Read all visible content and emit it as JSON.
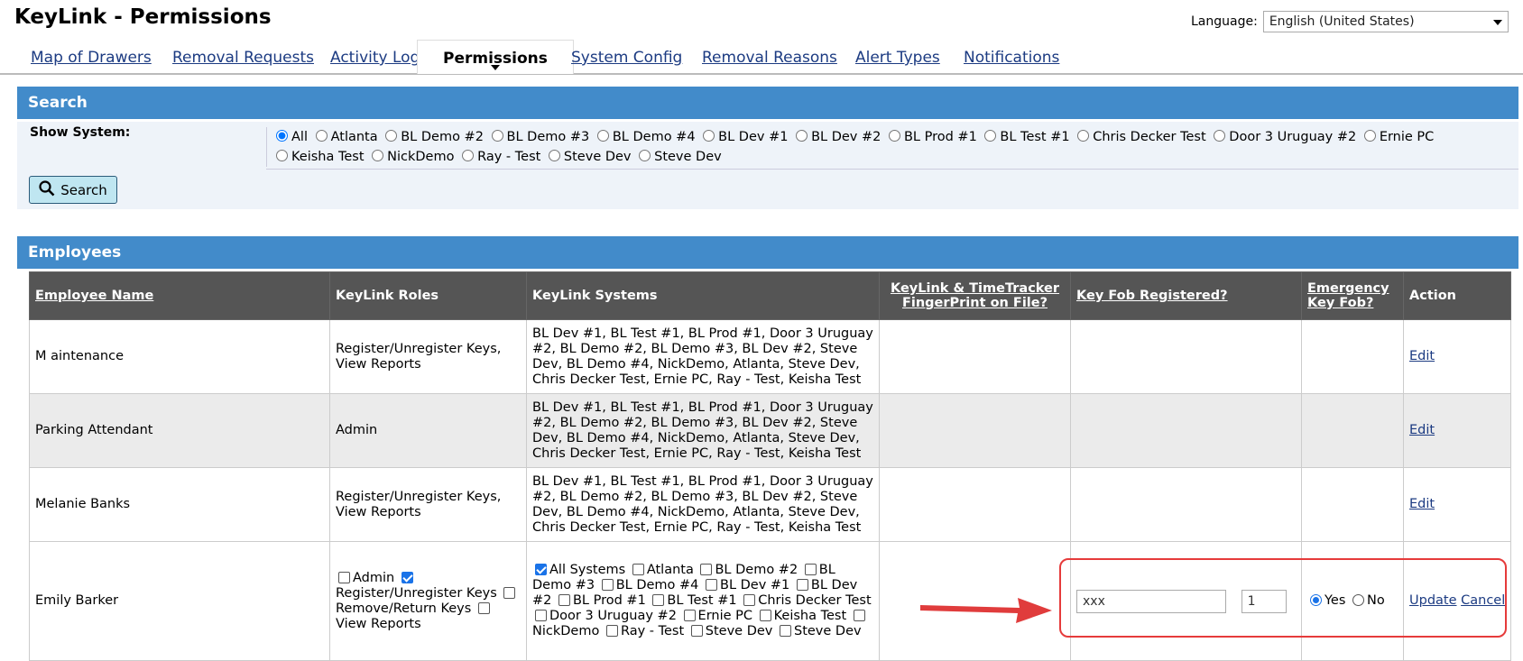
{
  "app_title": "KeyLink - Permissions",
  "language": {
    "label": "Language:",
    "value": "English (United States)"
  },
  "tabs": [
    {
      "label": "Map of Drawers"
    },
    {
      "label": "Removal Requests"
    },
    {
      "label": "Activity Log"
    },
    {
      "label": "Permissions",
      "active": true
    },
    {
      "label": "System Config"
    },
    {
      "label": "Removal Reasons"
    },
    {
      "label": "Alert Types"
    },
    {
      "label": "Notifications"
    }
  ],
  "search": {
    "heading": "Search",
    "show_system_label": "Show System:",
    "systems": [
      "All",
      "Atlanta",
      "BL Demo #2",
      "BL Demo #3",
      "BL Demo #4",
      "BL Dev #1",
      "BL Dev #2",
      "BL Prod #1",
      "BL Test #1",
      "Chris Decker Test",
      "Door 3 Uruguay #2",
      "Ernie PC",
      "Keisha Test",
      "NickDemo",
      "Ray - Test",
      "Steve Dev",
      "Steve Dev"
    ],
    "selected": "All",
    "button_label": "Search"
  },
  "employees": {
    "heading": "Employees",
    "columns": [
      "Employee Name",
      "KeyLink Roles",
      "KeyLink Systems",
      "KeyLink & TimeTracker FingerPrint on File?",
      "Key Fob Registered?",
      "Emergency Key Fob?",
      "Action"
    ],
    "rows": [
      {
        "name": "M aintenance",
        "roles": "Register/Unregister Keys, View Reports",
        "systems": "BL Dev #1, BL Test #1, BL Prod #1, Door 3 Uruguay #2, BL Demo #2, BL Demo #3, BL Dev #2, Steve Dev, BL Demo #4, NickDemo, Atlanta, Steve Dev, Chris Decker Test, Ernie PC, Ray - Test, Keisha Test",
        "fingerprint": "",
        "keyfob": "",
        "emergency": "",
        "action": "Edit"
      },
      {
        "name": "Parking Attendant",
        "roles": "Admin",
        "systems": "BL Dev #1, BL Test #1, BL Prod #1, Door 3 Uruguay #2, BL Demo #2, BL Demo #3, BL Dev #2, Steve Dev, BL Demo #4, NickDemo, Atlanta, Steve Dev, Chris Decker Test, Ernie PC, Ray - Test, Keisha Test",
        "fingerprint": "",
        "keyfob": "",
        "emergency": "",
        "action": "Edit"
      },
      {
        "name": "Melanie Banks",
        "roles": "Register/Unregister Keys, View Reports",
        "systems": "BL Dev #1, BL Test #1, BL Prod #1, Door 3 Uruguay #2, BL Demo #2, BL Demo #3, BL Dev #2, Steve Dev, BL Demo #4, NickDemo, Atlanta, Steve Dev, Chris Decker Test, Ernie PC, Ray - Test, Keisha Test",
        "fingerprint": "",
        "keyfob": "",
        "emergency": "",
        "action": "Edit"
      }
    ],
    "edit_row": {
      "name": "Emily Barker",
      "roles": [
        {
          "label": "Admin",
          "checked": false
        },
        {
          "label": "Register/Unregister Keys",
          "checked": true
        },
        {
          "label": "Remove/Return Keys",
          "checked": false
        },
        {
          "label": "View Reports",
          "checked": false
        }
      ],
      "systems": [
        {
          "label": "All Systems",
          "checked": true
        },
        {
          "label": "Atlanta",
          "checked": false
        },
        {
          "label": "BL Demo #2",
          "checked": false
        },
        {
          "label": "BL Demo #3",
          "checked": false
        },
        {
          "label": "BL Demo #4",
          "checked": false
        },
        {
          "label": "BL Dev #1",
          "checked": false
        },
        {
          "label": "BL Dev #2",
          "checked": false
        },
        {
          "label": "BL Prod #1",
          "checked": false
        },
        {
          "label": "BL Test #1",
          "checked": false
        },
        {
          "label": "Chris Decker Test",
          "checked": false
        },
        {
          "label": "Door 3 Uruguay #2",
          "checked": false
        },
        {
          "label": "Ernie PC",
          "checked": false
        },
        {
          "label": "Keisha Test",
          "checked": false
        },
        {
          "label": "NickDemo",
          "checked": false
        },
        {
          "label": "Ray - Test",
          "checked": false
        },
        {
          "label": "Steve Dev",
          "checked": false
        },
        {
          "label": "Steve Dev",
          "checked": false
        }
      ],
      "keyfob_value": "xxx",
      "keyfob_number": "1",
      "emergency": {
        "yes_label": "Yes",
        "no_label": "No",
        "selected": "Yes"
      },
      "update_label": "Update",
      "cancel_label": "Cancel"
    }
  },
  "colors": {
    "panel_header": "#428bca",
    "table_header": "#555555",
    "link": "#1c3b82",
    "annotation": "#e63b3b"
  }
}
